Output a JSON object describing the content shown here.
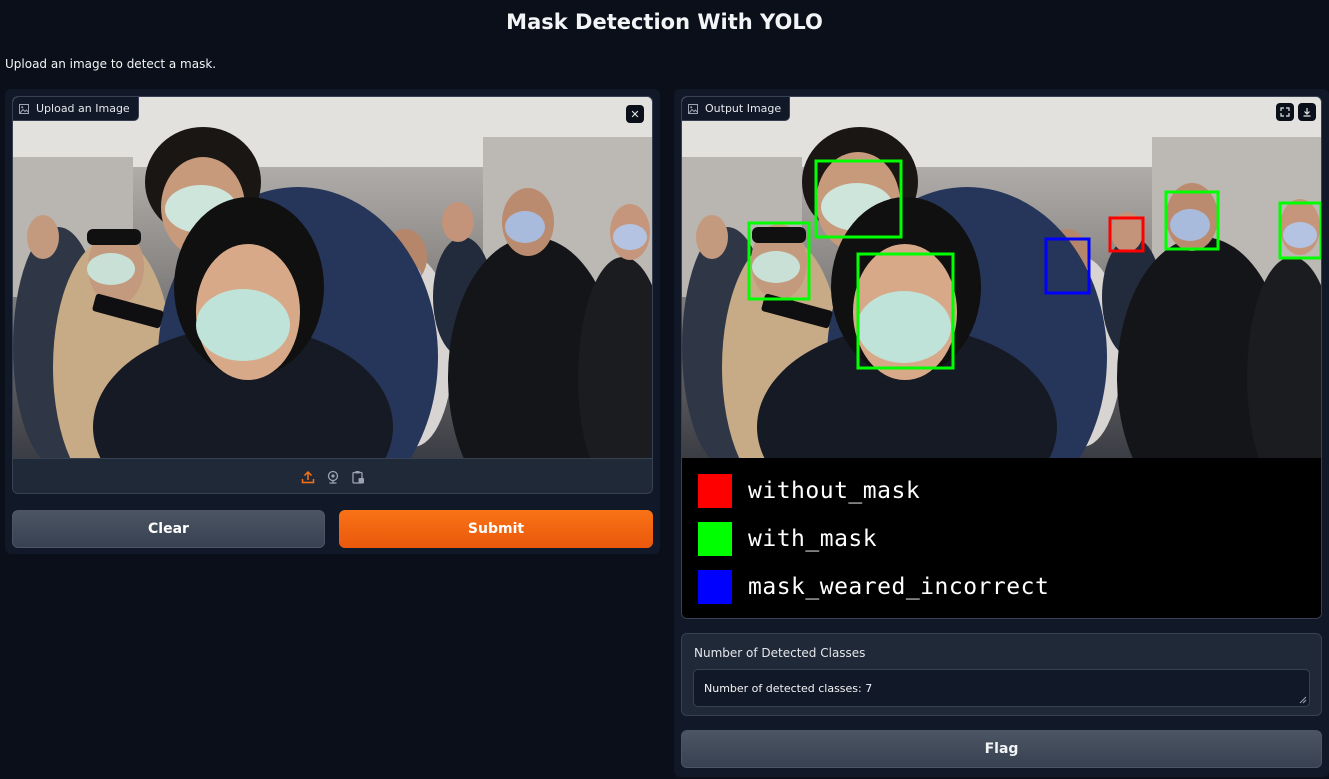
{
  "header": {
    "title": "Mask Detection With YOLO",
    "description": "Upload an image to detect a mask."
  },
  "input": {
    "label": "Upload an Image",
    "label_icon": "image-icon",
    "clear_icon": "close-icon",
    "sources": [
      "upload-icon",
      "webcam-icon",
      "clipboard-icon"
    ]
  },
  "buttons": {
    "clear": "Clear",
    "submit": "Submit",
    "flag": "Flag"
  },
  "output": {
    "label": "Output Image",
    "label_icon": "image-icon",
    "fullscreen_icon": "fullscreen-icon",
    "download_icon": "download-icon",
    "legend": [
      {
        "label": "without_mask",
        "color": "#ff0000"
      },
      {
        "label": "with_mask",
        "color": "#00ff00"
      },
      {
        "label": "mask_weared_incorrect",
        "color": "#0000ff"
      }
    ]
  },
  "result": {
    "label": "Number of Detected Classes",
    "value": "Number of detected classes: 7"
  },
  "colors": {
    "background": "#0b0f19",
    "panel": "#111827",
    "accent": "#f97316",
    "secondary_button": "#4b5563"
  }
}
